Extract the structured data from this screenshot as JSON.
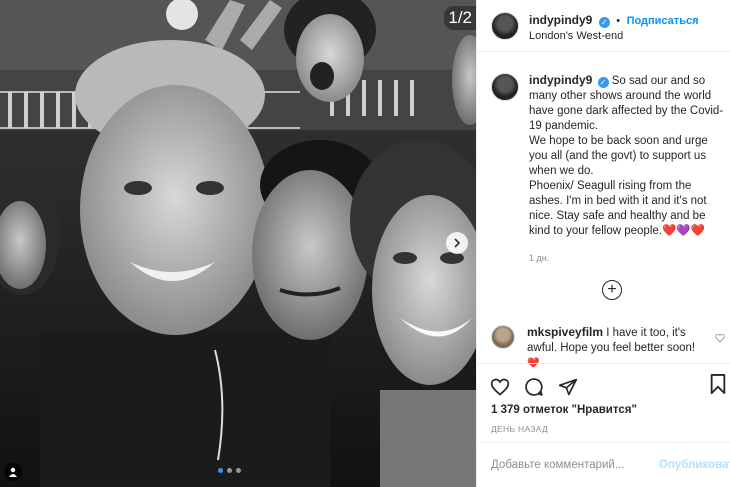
{
  "photo": {
    "counter": "1/2",
    "description_icon": "user-tag-icon"
  },
  "header": {
    "username": "indypindy9",
    "separator": "•",
    "follow_label": "Подписаться",
    "location": "London's West-end",
    "more_label": "..."
  },
  "caption": {
    "username": "indypindy9",
    "lines": [
      "So sad our and so",
      "many other shows around the world",
      "have gone dark affected by the Covid-",
      "19 pandemic.",
      "We hope to be back soon and urge",
      "you all (and the govt) to support us",
      "when we do.",
      "Phoenix/ Seagull rising from the",
      "ashes. I'm in bed with it and it's not",
      "nice. Stay safe and healthy and be",
      "kind to your fellow people."
    ],
    "emoji": "❤️💜❤️",
    "time": "1 дн."
  },
  "comment": {
    "username": "mkspiveyfilm",
    "text_line1": "I have it too, it's",
    "text_line2": "awful. Hope you feel better soon!",
    "emoji": "❤️"
  },
  "actions": {
    "like_icon": "heart-icon",
    "comment_icon": "comment-icon",
    "share_icon": "share-icon",
    "save_icon": "bookmark-icon"
  },
  "likes": "1 379 отметок \"Нравится\"",
  "date": "ДЕНЬ НАЗАД",
  "add_comment": {
    "placeholder": "Добавьте комментарий...",
    "publish_label": "Опубликовать"
  },
  "colors": {
    "link": "#0095f6",
    "publish_disabled": "#b2dffc",
    "muted": "#8e8e8e",
    "verified": "#3897f0"
  }
}
